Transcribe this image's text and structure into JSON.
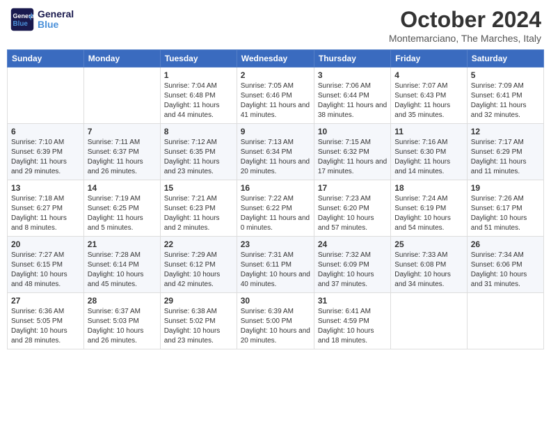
{
  "header": {
    "logo_line1": "General",
    "logo_line2": "Blue",
    "month": "October 2024",
    "location": "Montemarciano, The Marches, Italy"
  },
  "days_of_week": [
    "Sunday",
    "Monday",
    "Tuesday",
    "Wednesday",
    "Thursday",
    "Friday",
    "Saturday"
  ],
  "weeks": [
    [
      {
        "day": "",
        "info": ""
      },
      {
        "day": "",
        "info": ""
      },
      {
        "day": "1",
        "info": "Sunrise: 7:04 AM\nSunset: 6:48 PM\nDaylight: 11 hours and 44 minutes."
      },
      {
        "day": "2",
        "info": "Sunrise: 7:05 AM\nSunset: 6:46 PM\nDaylight: 11 hours and 41 minutes."
      },
      {
        "day": "3",
        "info": "Sunrise: 7:06 AM\nSunset: 6:44 PM\nDaylight: 11 hours and 38 minutes."
      },
      {
        "day": "4",
        "info": "Sunrise: 7:07 AM\nSunset: 6:43 PM\nDaylight: 11 hours and 35 minutes."
      },
      {
        "day": "5",
        "info": "Sunrise: 7:09 AM\nSunset: 6:41 PM\nDaylight: 11 hours and 32 minutes."
      }
    ],
    [
      {
        "day": "6",
        "info": "Sunrise: 7:10 AM\nSunset: 6:39 PM\nDaylight: 11 hours and 29 minutes."
      },
      {
        "day": "7",
        "info": "Sunrise: 7:11 AM\nSunset: 6:37 PM\nDaylight: 11 hours and 26 minutes."
      },
      {
        "day": "8",
        "info": "Sunrise: 7:12 AM\nSunset: 6:35 PM\nDaylight: 11 hours and 23 minutes."
      },
      {
        "day": "9",
        "info": "Sunrise: 7:13 AM\nSunset: 6:34 PM\nDaylight: 11 hours and 20 minutes."
      },
      {
        "day": "10",
        "info": "Sunrise: 7:15 AM\nSunset: 6:32 PM\nDaylight: 11 hours and 17 minutes."
      },
      {
        "day": "11",
        "info": "Sunrise: 7:16 AM\nSunset: 6:30 PM\nDaylight: 11 hours and 14 minutes."
      },
      {
        "day": "12",
        "info": "Sunrise: 7:17 AM\nSunset: 6:29 PM\nDaylight: 11 hours and 11 minutes."
      }
    ],
    [
      {
        "day": "13",
        "info": "Sunrise: 7:18 AM\nSunset: 6:27 PM\nDaylight: 11 hours and 8 minutes."
      },
      {
        "day": "14",
        "info": "Sunrise: 7:19 AM\nSunset: 6:25 PM\nDaylight: 11 hours and 5 minutes."
      },
      {
        "day": "15",
        "info": "Sunrise: 7:21 AM\nSunset: 6:23 PM\nDaylight: 11 hours and 2 minutes."
      },
      {
        "day": "16",
        "info": "Sunrise: 7:22 AM\nSunset: 6:22 PM\nDaylight: 11 hours and 0 minutes."
      },
      {
        "day": "17",
        "info": "Sunrise: 7:23 AM\nSunset: 6:20 PM\nDaylight: 10 hours and 57 minutes."
      },
      {
        "day": "18",
        "info": "Sunrise: 7:24 AM\nSunset: 6:19 PM\nDaylight: 10 hours and 54 minutes."
      },
      {
        "day": "19",
        "info": "Sunrise: 7:26 AM\nSunset: 6:17 PM\nDaylight: 10 hours and 51 minutes."
      }
    ],
    [
      {
        "day": "20",
        "info": "Sunrise: 7:27 AM\nSunset: 6:15 PM\nDaylight: 10 hours and 48 minutes."
      },
      {
        "day": "21",
        "info": "Sunrise: 7:28 AM\nSunset: 6:14 PM\nDaylight: 10 hours and 45 minutes."
      },
      {
        "day": "22",
        "info": "Sunrise: 7:29 AM\nSunset: 6:12 PM\nDaylight: 10 hours and 42 minutes."
      },
      {
        "day": "23",
        "info": "Sunrise: 7:31 AM\nSunset: 6:11 PM\nDaylight: 10 hours and 40 minutes."
      },
      {
        "day": "24",
        "info": "Sunrise: 7:32 AM\nSunset: 6:09 PM\nDaylight: 10 hours and 37 minutes."
      },
      {
        "day": "25",
        "info": "Sunrise: 7:33 AM\nSunset: 6:08 PM\nDaylight: 10 hours and 34 minutes."
      },
      {
        "day": "26",
        "info": "Sunrise: 7:34 AM\nSunset: 6:06 PM\nDaylight: 10 hours and 31 minutes."
      }
    ],
    [
      {
        "day": "27",
        "info": "Sunrise: 6:36 AM\nSunset: 5:05 PM\nDaylight: 10 hours and 28 minutes."
      },
      {
        "day": "28",
        "info": "Sunrise: 6:37 AM\nSunset: 5:03 PM\nDaylight: 10 hours and 26 minutes."
      },
      {
        "day": "29",
        "info": "Sunrise: 6:38 AM\nSunset: 5:02 PM\nDaylight: 10 hours and 23 minutes."
      },
      {
        "day": "30",
        "info": "Sunrise: 6:39 AM\nSunset: 5:00 PM\nDaylight: 10 hours and 20 minutes."
      },
      {
        "day": "31",
        "info": "Sunrise: 6:41 AM\nSunset: 4:59 PM\nDaylight: 10 hours and 18 minutes."
      },
      {
        "day": "",
        "info": ""
      },
      {
        "day": "",
        "info": ""
      }
    ]
  ]
}
